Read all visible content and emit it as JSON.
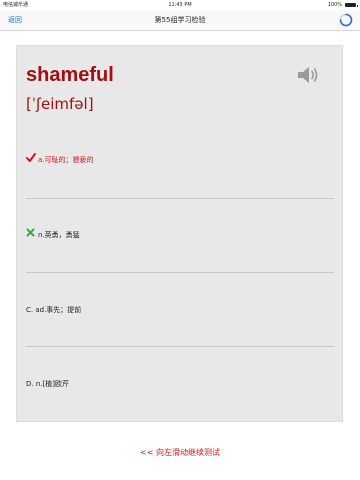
{
  "status_bar": {
    "carrier": "电信诚乐通",
    "time": "11:43 PM",
    "battery": "100%"
  },
  "nav": {
    "back_label": "返回",
    "title": "第55组学习检验"
  },
  "quiz": {
    "word": "shameful",
    "phonetic": "[ˈʃeimfəl]",
    "options": [
      {
        "label": "a.可耻的；猥亵的",
        "state": "correct",
        "mark": "✔"
      },
      {
        "label": "n.英勇，勇猛",
        "state": "wrong",
        "mark": "✖"
      },
      {
        "label": "C. ad.事先；提前",
        "state": "none",
        "mark": ""
      },
      {
        "label": "D. n.[植]欧芹",
        "state": "none",
        "mark": ""
      }
    ]
  },
  "footer": {
    "swipe_hint": "<< 向左滑动继续测试"
  },
  "colors": {
    "accent_red": "#a40f0f",
    "correct_red": "#d6131b",
    "wrong_green": "#2db33a",
    "link_blue": "#1a73e8"
  },
  "icons": {
    "speaker": "speaker-icon",
    "correct": "checkmark-icon",
    "wrong": "cross-icon",
    "spinner": "loading-spinner-icon"
  }
}
